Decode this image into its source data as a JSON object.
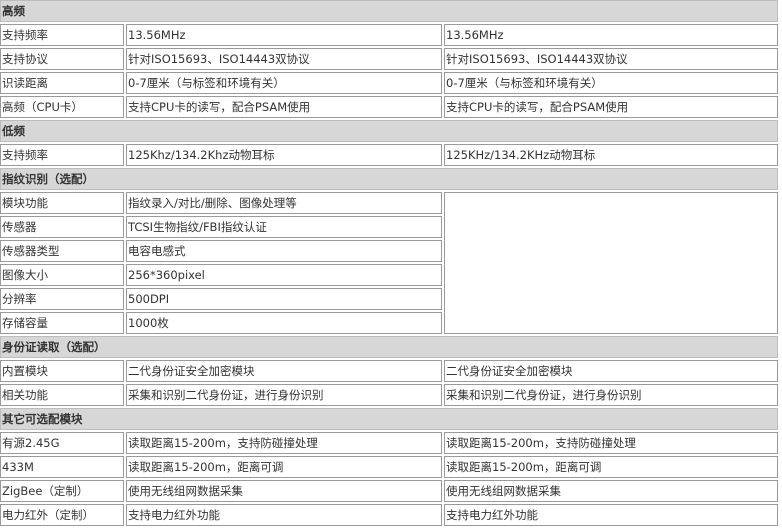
{
  "sections": [
    {
      "title": "高频",
      "rows": [
        {
          "label": "支持频率",
          "c1": "13.56MHz",
          "c2": "13.56MHz"
        },
        {
          "label": "支持协议",
          "c1": "针对ISO15693、ISO14443双协议",
          "c2": "针对ISO15693、ISO14443双协议"
        },
        {
          "label": "识读距离",
          "c1": "0-7厘米（与标签和环境有关）",
          "c2": "0-7厘米（与标签和环境有关）"
        },
        {
          "label": "高频（CPU卡）",
          "c1": "支持CPU卡的读写，配合PSAM使用",
          "c2": "支持CPU卡的读写，配合PSAM使用"
        }
      ]
    },
    {
      "title": "低频",
      "rows": [
        {
          "label": "支持频率",
          "c1": "125Khz/134.2Khz动物耳标",
          "c2": "125KHz/134.2KHz动物耳标"
        }
      ]
    },
    {
      "title": "指纹识别（选配）",
      "rows": [
        {
          "label": "模块功能",
          "c1": "指纹录入/对比/删除、图像处理等"
        },
        {
          "label": "传感器",
          "c1": "TCSI生物指纹/FBI指纹认证"
        },
        {
          "label": "传感器类型",
          "c1": "电容电感式"
        },
        {
          "label": "图像大小",
          "c1": "256*360pixel"
        },
        {
          "label": "分辨率",
          "c1": "500DPI"
        },
        {
          "label": "存储容量",
          "c1": "1000枚"
        }
      ]
    },
    {
      "title": "身份证读取（选配）",
      "rows": [
        {
          "label": "内置模块",
          "c1": "二代身份证安全加密模块",
          "c2": "二代身份证安全加密模块"
        },
        {
          "label": "相关功能",
          "c1": "采集和识别二代身份证，进行身份识别",
          "c2": "采集和识别二代身份证，进行身份识别"
        }
      ]
    },
    {
      "title": "其它可选配模块",
      "rows": [
        {
          "label": "有源2.45G",
          "c1": "读取距离15-200m，支持防碰撞处理",
          "c2": "读取距离15-200m，支持防碰撞处理"
        },
        {
          "label": "433M",
          "c1": "读取距离15-200m，距离可调",
          "c2": "读取距离15-200m，距离可调"
        },
        {
          "label": "ZigBee（定制）",
          "c1": "使用无线组网数据采集",
          "c2": "使用无线组网数据采集"
        },
        {
          "label": "电力红外（定制）",
          "c1": "支持电力红外功能",
          "c2": "支持电力红外功能"
        }
      ]
    }
  ]
}
